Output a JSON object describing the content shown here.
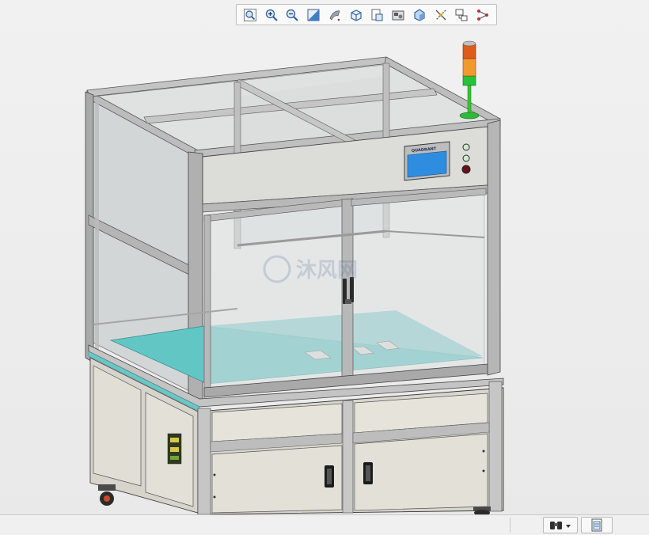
{
  "toolbar": {
    "buttons": [
      {
        "id": "zoom-to-fit",
        "icon": "zoom-to-fit-icon"
      },
      {
        "id": "zoom-in",
        "icon": "zoom-in-icon"
      },
      {
        "id": "zoom-out",
        "icon": "zoom-out-icon"
      },
      {
        "id": "section-view",
        "icon": "section-view-icon"
      },
      {
        "id": "view-orientation",
        "icon": "view-orientation-icon"
      },
      {
        "id": "display-style",
        "icon": "display-style-icon"
      },
      {
        "id": "hide-show-items",
        "icon": "hide-show-items-icon"
      },
      {
        "id": "edit-appearance",
        "icon": "edit-appearance-icon"
      },
      {
        "id": "apply-scene",
        "icon": "apply-scene-icon"
      },
      {
        "id": "view-settings",
        "icon": "view-settings-icon"
      },
      {
        "id": "display-pane",
        "icon": "display-pane-icon"
      },
      {
        "id": "view-palette",
        "icon": "view-palette-icon"
      }
    ]
  },
  "model": {
    "hmi_brand": "QUADRANT",
    "watermark": "沐风网"
  },
  "colors": {
    "frame": "#b9b9b9",
    "frame_dark": "#6d6d6d",
    "glass": "#d2d5d5",
    "teal_plate": "#5cc4c4",
    "cabinet": "#dedbd2",
    "hmi_screen": "#2f8de0",
    "tower_red": "#e05a1e",
    "tower_orange": "#f0a030",
    "tower_green": "#27c23a"
  },
  "statusbar": {
    "buttons": [
      {
        "id": "binoculars",
        "icon": "binoculars-icon"
      },
      {
        "id": "rebuild",
        "icon": "document-icon"
      }
    ]
  }
}
